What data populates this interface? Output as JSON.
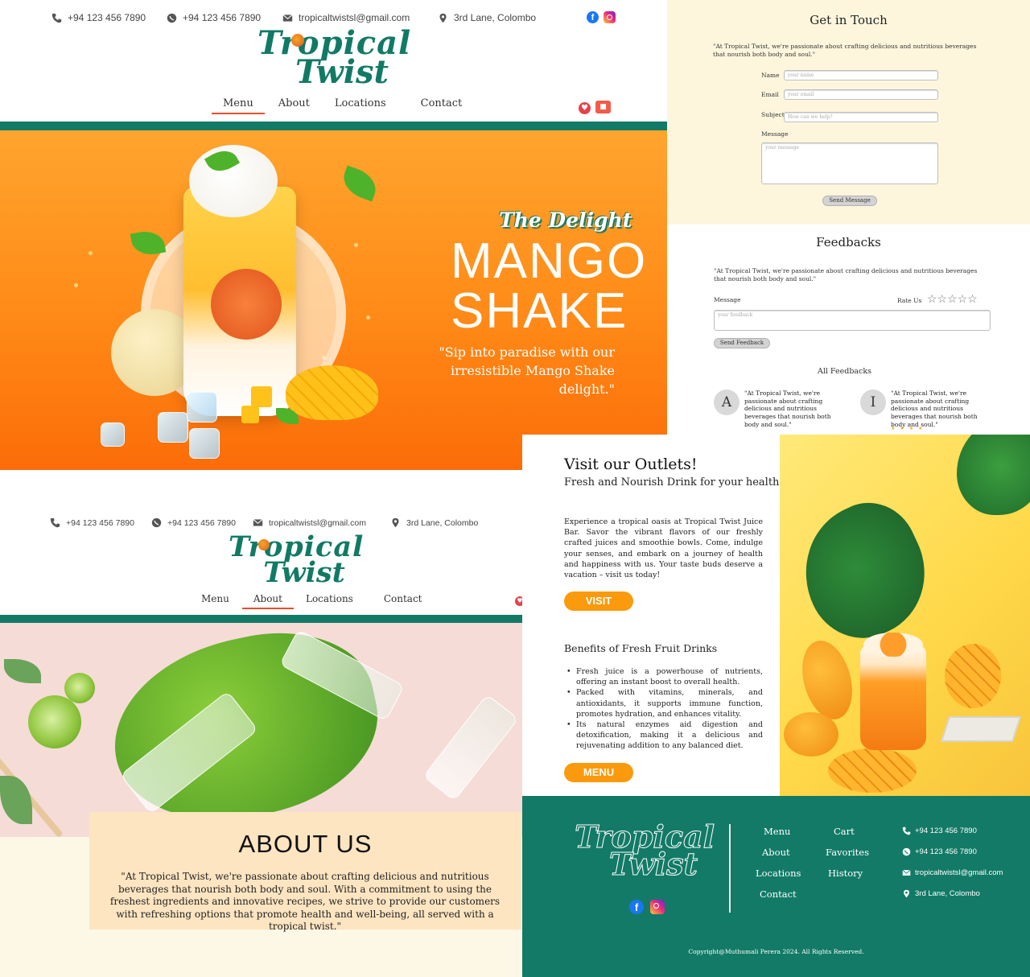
{
  "brand": {
    "line1": "Tropical",
    "line2": "Twist"
  },
  "contact": {
    "phone1": "+94 123 456 7890",
    "phone2": "+94 123 456 7890",
    "email": "tropicaltwistsl@gmail.com",
    "address": "3rd Lane, Colombo"
  },
  "social": {
    "facebook_glyph": "f",
    "icons": [
      "facebook-icon",
      "instagram-icon"
    ]
  },
  "nav": {
    "items": [
      {
        "label": "Menu"
      },
      {
        "label": "About"
      },
      {
        "label": "Locations"
      },
      {
        "label": "Contact"
      }
    ],
    "home_active": "Menu",
    "about_active": "About"
  },
  "header_icons": {
    "heart": "♥",
    "cart": "■"
  },
  "hero": {
    "kicker": "The Delight",
    "title_line1": "MANGO",
    "title_line2": "SHAKE",
    "quote": "\"Sip into paradise with our irresistible Mango Shake delight.\""
  },
  "contact_form": {
    "title": "Get in Touch",
    "quote": "\"At Tropical Twist, we're passionate about crafting delicious and nutritious beverages that nourish both body and soul.\"",
    "name_label": "Name",
    "name_placeholder": "your name",
    "email_label": "Email",
    "email_placeholder": "your email",
    "subject_label": "Subject",
    "subject_placeholder": "How can we help?",
    "message_label": "Message",
    "message_placeholder": "your message",
    "submit_label": "Send Message"
  },
  "feedback": {
    "title": "Feedbacks",
    "quote": "\"At Tropical Twist, we're passionate about crafting delicious and nutritious beverages that nourish both body and soul.\"",
    "message_label": "Message",
    "rate_label": "Rate Us",
    "stars": "☆☆☆☆☆",
    "placeholder": "your feedback",
    "submit_label": "Send Feedback",
    "all_title": "All Feedbacks",
    "items": [
      {
        "initial": "A",
        "text": "\"At Tropical Twist, we're passionate about crafting delicious and nutritious beverages that nourish both body and soul.\""
      },
      {
        "initial": "I",
        "text": "\"At Tropical Twist, we're passionate about crafting delicious and nutritious beverages that nourish both body and soul.\""
      }
    ],
    "item_stars": "★★★★"
  },
  "about": {
    "title": "ABOUT US",
    "text": "\"At Tropical Twist, we're passionate about crafting delicious and nutritious beverages that nourish both body and soul. With a commitment to using the freshest ingredients and innovative recipes, we strive to provide our customers with refreshing options that promote health and well-being, all served with a tropical twist.\""
  },
  "outlets": {
    "title": "Visit our Outlets!",
    "subtitle": "Fresh and Nourish Drink for your health",
    "text": "Experience a tropical oasis at Tropical Twist Juice Bar. Savor the vibrant flavors of our freshly crafted juices and smoothie bowls. Come, indulge your senses, and embark on a journey of health and happiness with us. Your taste buds deserve a vacation – visit us today!",
    "visit_label": "VISIT",
    "benefits_title": "Benefits of Fresh Fruit Drinks",
    "benefits": [
      "Fresh juice is a powerhouse of nutrients, offering an instant boost to overall health.",
      "Packed with vitamins, minerals, and antioxidants, it supports immune function, promotes hydration, and enhances vitality.",
      "Its natural enzymes aid digestion and detoxification, making it a delicious and rejuvenating addition to any balanced diet."
    ],
    "menu_label": "MENU"
  },
  "footer": {
    "col1": [
      "Menu",
      "About",
      "Locations",
      "Contact"
    ],
    "col2": [
      "Cart",
      "Favorites",
      "History"
    ],
    "phone1": "+94 123 456 7890",
    "phone2": "+94 123 456 7890",
    "email": "tropicaltwistsl@gmail.com",
    "address": "3rd Lane, Colombo",
    "copyright": "Copyright@Muthumali Perera 2024. All Rights Reserved."
  },
  "colors": {
    "teal": "#137a67",
    "orange": "#fb9a0c",
    "accent_red": "#e5502a",
    "cream": "#fdf6dd"
  }
}
